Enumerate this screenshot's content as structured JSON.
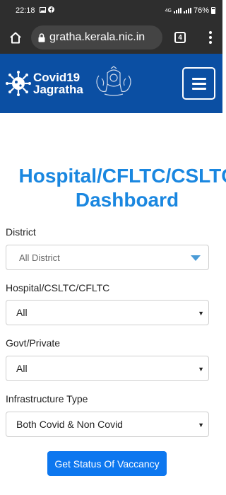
{
  "status_bar": {
    "time": "22:18",
    "network": "4G",
    "battery": "76%",
    "icons": [
      "image-icon",
      "facebook-icon",
      "signal-icon",
      "battery-icon"
    ]
  },
  "browser": {
    "url": "gratha.kerala.nic.in",
    "tab_count": "4",
    "icons": [
      "home-icon",
      "lock-icon",
      "tabs-icon",
      "more-vert-icon"
    ]
  },
  "header": {
    "logo_line1": "Covid19",
    "logo_line2": "Jagratha",
    "brand_color": "#0b4fa3",
    "icons": [
      "virus-logo-icon",
      "kerala-emblem-icon",
      "hamburger-menu-icon"
    ]
  },
  "main": {
    "title_line1": "Hospital/CFLTC/CSLTC",
    "title_line2": "Dashboard",
    "title_color": "#1a87e0",
    "fields": [
      {
        "label": "District",
        "value": "All District"
      },
      {
        "label": "Hospital/CSLTC/CFLTC",
        "value": "All"
      },
      {
        "label": "Govt/Private",
        "value": "All"
      },
      {
        "label": "Infrastructure Type",
        "value": "Both Covid & Non Covid"
      }
    ],
    "submit_label": "Get Status Of Vaccancy",
    "button_color": "#0d77ef"
  }
}
